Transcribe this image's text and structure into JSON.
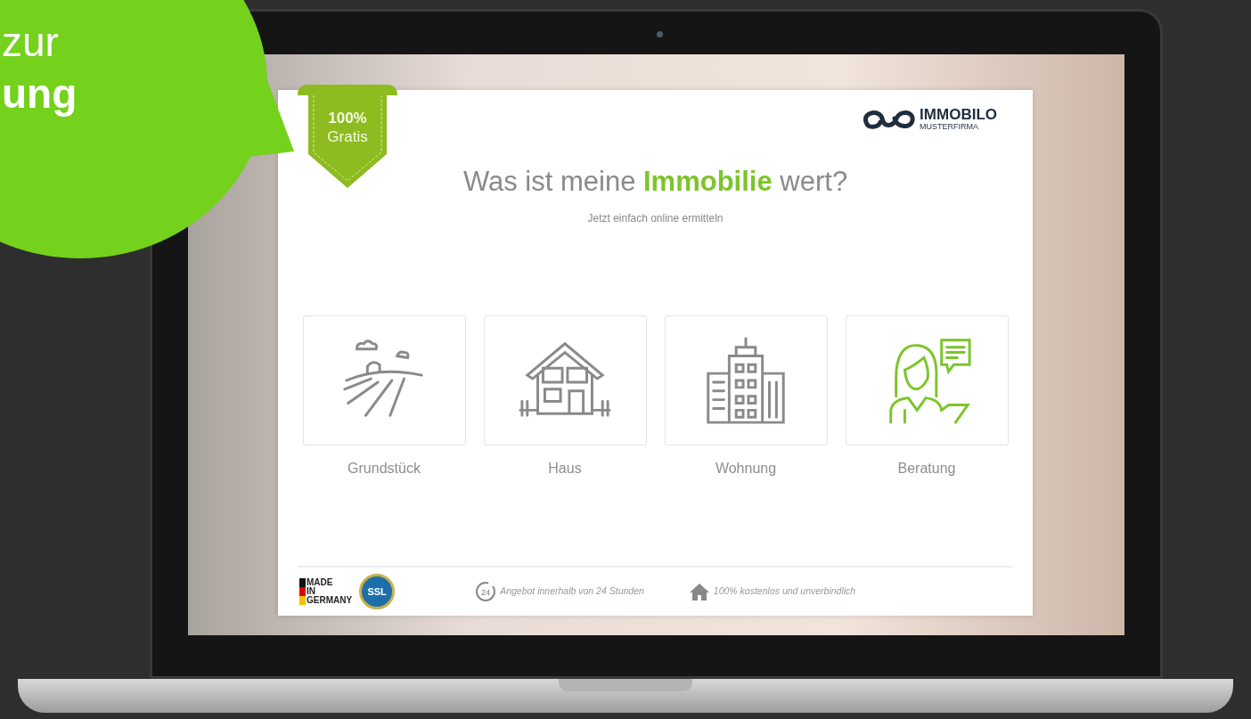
{
  "promo_bubble": {
    "lines": [
      "zur",
      "ung"
    ]
  },
  "ribbon": {
    "lines": [
      "100%",
      "Gratis"
    ]
  },
  "logo": {
    "name": "IMMOBILO",
    "subtitle": "MUSTERFIRMA"
  },
  "headline": "Was ist meine **Immobilie** wert?",
  "subheadline": "Jetzt einfach online ermitteln",
  "options": [
    {
      "label": "Grundstück",
      "kind": "land"
    },
    {
      "label": "Haus",
      "kind": "house"
    },
    {
      "label": "Wohnung",
      "kind": "apartment"
    },
    {
      "label": "Beratung",
      "kind": "consulting"
    }
  ],
  "footer": {
    "made_in": [
      "MADE",
      "IN",
      "GERMANY"
    ],
    "ssl": "SSL",
    "features": [
      {
        "kind": "clock",
        "text": "Angebot innerhalb von 24 Stunden",
        "badge": "24"
      },
      {
        "kind": "home",
        "text": "100% kostenlos und unverbindlich"
      }
    ]
  }
}
